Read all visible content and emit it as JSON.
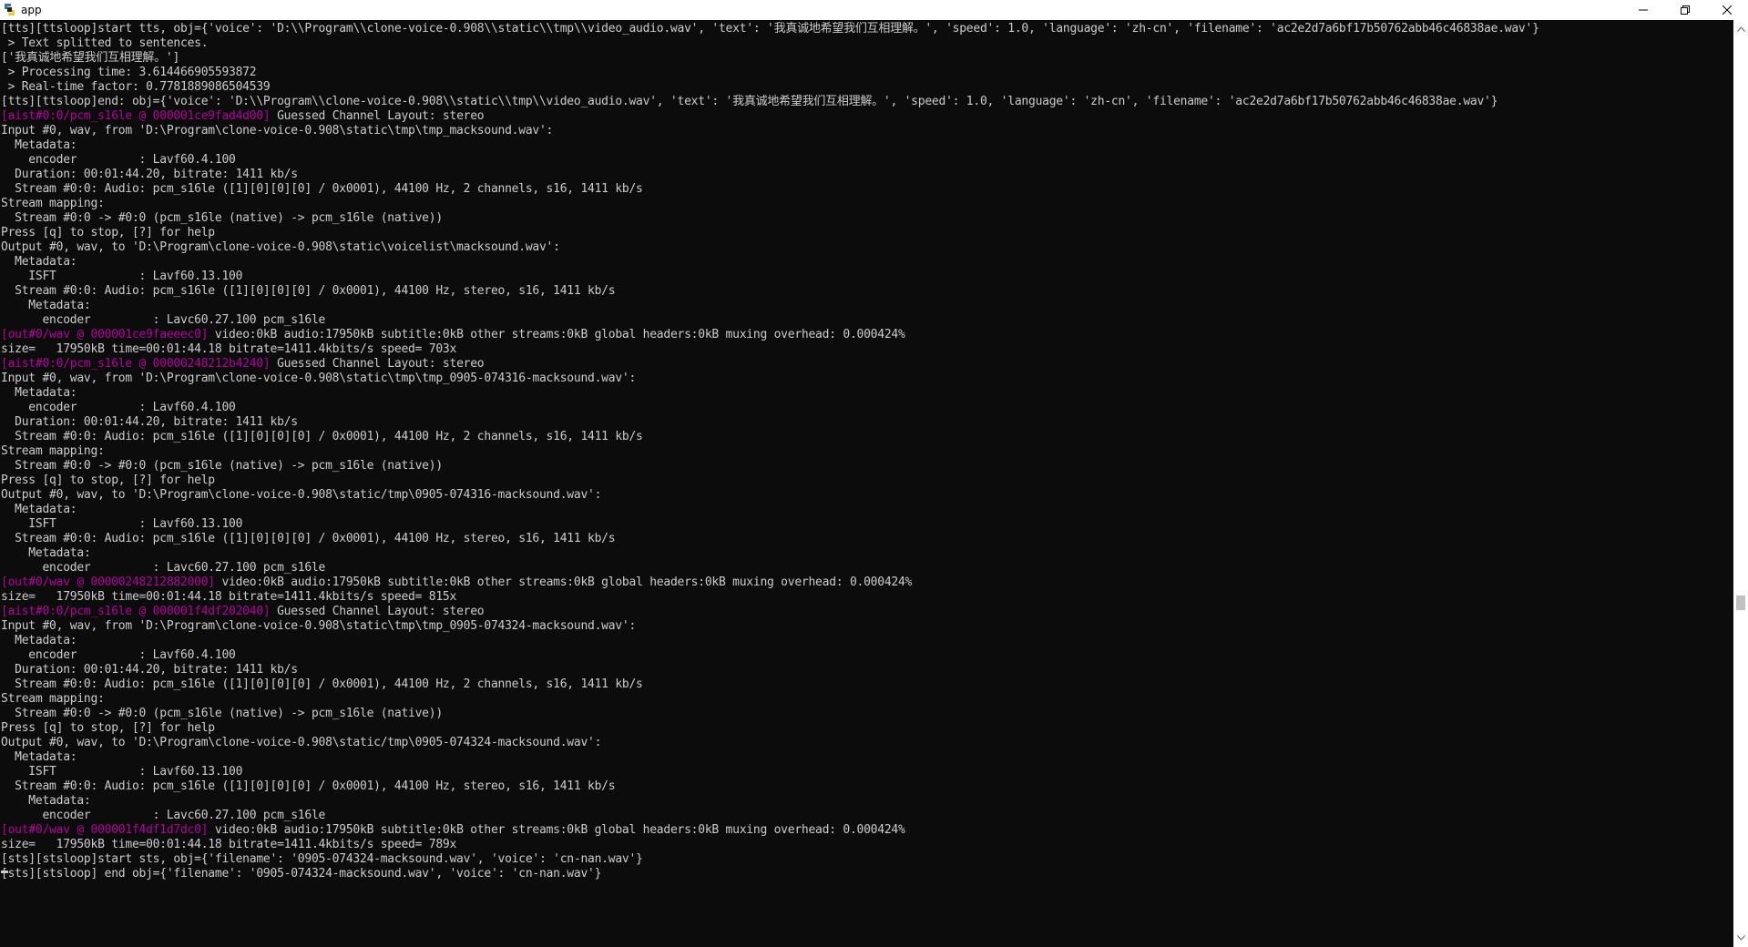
{
  "window": {
    "title": "app",
    "icon": "python-app-icon",
    "controls": [
      "minimize-icon",
      "restore-icon",
      "close-icon"
    ]
  },
  "colors": {
    "background": "#0c0c0c",
    "text": "#cccccc",
    "magenta": "#b4009e",
    "titlebar": "#ffffff"
  },
  "console": {
    "lines": [
      {
        "text": "[tts][ttsloop]start tts, obj={'voice': 'D:\\\\Program\\\\clone-voice-0.908\\\\static\\\\tmp\\\\video_audio.wav', 'text': '我真诚地希望我们互相理解。', 'speed': 1.0, 'language': 'zh-cn', 'filename': 'ac2e2d7a6bf17b50762abb46c46838ae.wav'}"
      },
      {
        "text": " > Text splitted to sentences."
      },
      {
        "text": "['我真诚地希望我们互相理解。']"
      },
      {
        "text": " > Processing time: 3.614466905593872"
      },
      {
        "text": " > Real-time factor: 0.7781889086504539"
      },
      {
        "text": "[tts][ttsloop]end: obj={'voice': 'D:\\\\Program\\\\clone-voice-0.908\\\\static\\\\tmp\\\\video_audio.wav', 'text': '我真诚地希望我们互相理解。', 'speed': 1.0, 'language': 'zh-cn', 'filename': 'ac2e2d7a6bf17b50762abb46c46838ae.wav'}"
      },
      {
        "prefix": "[aist#0:0/pcm_s16le @ 000001ce9fad4d00]",
        "text": " Guessed Channel Layout: stereo"
      },
      {
        "text": "Input #0, wav, from 'D:\\Program\\clone-voice-0.908\\static\\tmp\\tmp_macksound.wav':"
      },
      {
        "text": "  Metadata:"
      },
      {
        "text": "    encoder         : Lavf60.4.100"
      },
      {
        "text": "  Duration: 00:01:44.20, bitrate: 1411 kb/s"
      },
      {
        "text": "  Stream #0:0: Audio: pcm_s16le ([1][0][0][0] / 0x0001), 44100 Hz, 2 channels, s16, 1411 kb/s"
      },
      {
        "text": "Stream mapping:"
      },
      {
        "text": "  Stream #0:0 -> #0:0 (pcm_s16le (native) -> pcm_s16le (native))"
      },
      {
        "text": "Press [q] to stop, [?] for help"
      },
      {
        "text": "Output #0, wav, to 'D:\\Program\\clone-voice-0.908\\static\\voicelist\\macksound.wav':"
      },
      {
        "text": "  Metadata:"
      },
      {
        "text": "    ISFT            : Lavf60.13.100"
      },
      {
        "text": "  Stream #0:0: Audio: pcm_s16le ([1][0][0][0] / 0x0001), 44100 Hz, stereo, s16, 1411 kb/s"
      },
      {
        "text": "    Metadata:"
      },
      {
        "text": "      encoder         : Lavc60.27.100 pcm_s16le"
      },
      {
        "prefix": "[out#0/wav @ 000001ce9faeeec0]",
        "text": " video:0kB audio:17950kB subtitle:0kB other streams:0kB global headers:0kB muxing overhead: 0.000424%"
      },
      {
        "text": "size=   17950kB time=00:01:44.18 bitrate=1411.4kbits/s speed= 703x"
      },
      {
        "prefix": "[aist#0:0/pcm_s16le @ 00000248212b4240]",
        "text": " Guessed Channel Layout: stereo"
      },
      {
        "text": "Input #0, wav, from 'D:\\Program\\clone-voice-0.908\\static\\tmp\\tmp_0905-074316-macksound.wav':"
      },
      {
        "text": "  Metadata:"
      },
      {
        "text": "    encoder         : Lavf60.4.100"
      },
      {
        "text": "  Duration: 00:01:44.20, bitrate: 1411 kb/s"
      },
      {
        "text": "  Stream #0:0: Audio: pcm_s16le ([1][0][0][0] / 0x0001), 44100 Hz, 2 channels, s16, 1411 kb/s"
      },
      {
        "text": "Stream mapping:"
      },
      {
        "text": "  Stream #0:0 -> #0:0 (pcm_s16le (native) -> pcm_s16le (native))"
      },
      {
        "text": "Press [q] to stop, [?] for help"
      },
      {
        "text": "Output #0, wav, to 'D:\\Program\\clone-voice-0.908\\static/tmp\\0905-074316-macksound.wav':"
      },
      {
        "text": "  Metadata:"
      },
      {
        "text": "    ISFT            : Lavf60.13.100"
      },
      {
        "text": "  Stream #0:0: Audio: pcm_s16le ([1][0][0][0] / 0x0001), 44100 Hz, stereo, s16, 1411 kb/s"
      },
      {
        "text": "    Metadata:"
      },
      {
        "text": "      encoder         : Lavc60.27.100 pcm_s16le"
      },
      {
        "prefix": "[out#0/wav @ 00000248212882000]",
        "text": " video:0kB audio:17950kB subtitle:0kB other streams:0kB global headers:0kB muxing overhead: 0.000424%"
      },
      {
        "text": "size=   17950kB time=00:01:44.18 bitrate=1411.4kbits/s speed= 815x"
      },
      {
        "prefix": "[aist#0:0/pcm_s16le @ 000001f4df202040]",
        "text": " Guessed Channel Layout: stereo"
      },
      {
        "text": "Input #0, wav, from 'D:\\Program\\clone-voice-0.908\\static\\tmp\\tmp_0905-074324-macksound.wav':"
      },
      {
        "text": "  Metadata:"
      },
      {
        "text": "    encoder         : Lavf60.4.100"
      },
      {
        "text": "  Duration: 00:01:44.20, bitrate: 1411 kb/s"
      },
      {
        "text": "  Stream #0:0: Audio: pcm_s16le ([1][0][0][0] / 0x0001), 44100 Hz, 2 channels, s16, 1411 kb/s"
      },
      {
        "text": "Stream mapping:"
      },
      {
        "text": "  Stream #0:0 -> #0:0 (pcm_s16le (native) -> pcm_s16le (native))"
      },
      {
        "text": "Press [q] to stop, [?] for help"
      },
      {
        "text": "Output #0, wav, to 'D:\\Program\\clone-voice-0.908\\static/tmp\\0905-074324-macksound.wav':"
      },
      {
        "text": "  Metadata:"
      },
      {
        "text": "    ISFT            : Lavf60.13.100"
      },
      {
        "text": "  Stream #0:0: Audio: pcm_s16le ([1][0][0][0] / 0x0001), 44100 Hz, stereo, s16, 1411 kb/s"
      },
      {
        "text": "    Metadata:"
      },
      {
        "text": "      encoder         : Lavc60.27.100 pcm_s16le"
      },
      {
        "prefix": "[out#0/wav @ 000001f4df1d7dc0]",
        "text": " video:0kB audio:17950kB subtitle:0kB other streams:0kB global headers:0kB muxing overhead: 0.000424%"
      },
      {
        "text": "size=   17950kB time=00:01:44.18 bitrate=1411.4kbits/s speed= 789x"
      },
      {
        "text": "[sts][stsloop]start sts, obj={'filename': '0905-074324-macksound.wav', 'voice': 'cn-nan.wav'}"
      },
      {
        "text": "[sts][stsloop] end obj={'filename': '0905-074324-macksound.wav', 'voice': 'cn-nan.wav'}"
      }
    ]
  },
  "scrollbar": {
    "up_icon": "scroll-up-arrow-icon",
    "down_icon": "scroll-down-arrow-icon"
  }
}
